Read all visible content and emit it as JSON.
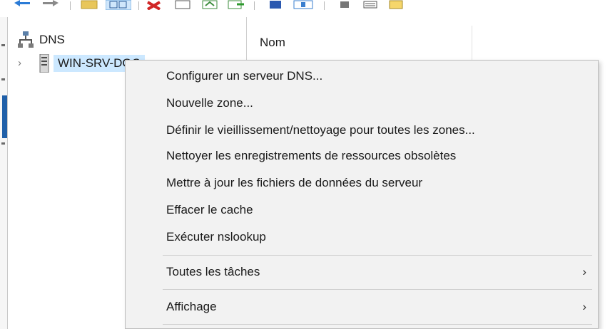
{
  "tree": {
    "root_label": "DNS",
    "server_label": "WIN-SRV-DOC",
    "chevron": "›"
  },
  "right_pane": {
    "column_header": "Nom"
  },
  "context_menu": {
    "items": [
      {
        "label": "Configurer un serveur DNS..."
      },
      {
        "label": "Nouvelle zone..."
      },
      {
        "label": "Définir le vieillissement/nettoyage pour toutes les zones..."
      },
      {
        "label": "Nettoyer les enregistrements de ressources obsolètes"
      },
      {
        "label": "Mettre à jour les fichiers de données du serveur"
      },
      {
        "label": "Effacer le cache"
      },
      {
        "label": "Exécuter nslookup"
      },
      {
        "label": "Toutes les tâches",
        "arrow": "›"
      },
      {
        "label": "Affichage",
        "arrow": "›"
      }
    ]
  },
  "colors": {
    "selection": "#cce8ff",
    "menu_bg": "#f2f2f2"
  }
}
